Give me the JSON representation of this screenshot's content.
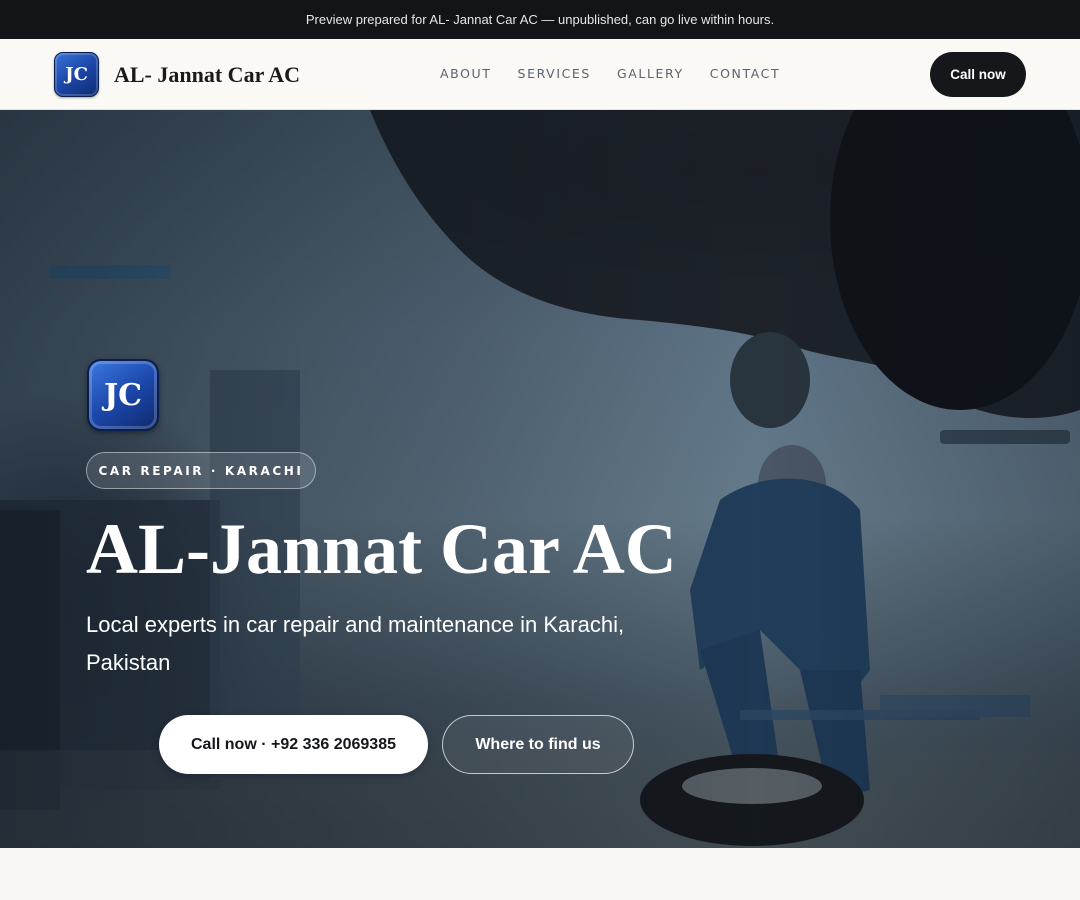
{
  "preview_bar": {
    "text": "Preview prepared for AL- Jannat Car AC — unpublished, can go live within hours."
  },
  "header": {
    "logo_initials": "JC",
    "brand_name": "AL- Jannat Car AC",
    "nav": [
      {
        "label": "ABOUT"
      },
      {
        "label": "SERVICES"
      },
      {
        "label": "GALLERY"
      },
      {
        "label": "CONTACT"
      }
    ],
    "call_label": "Call now"
  },
  "hero": {
    "logo_initials": "JC",
    "tag": "CAR REPAIR · KARACHI",
    "title": "AL-Jannat Car AC",
    "subtitle": "Local experts in car repair and maintenance in Karachi, Pakistan",
    "primary_cta": "Call now · +92 336 2069385",
    "secondary_cta": "Where to find us"
  },
  "colors": {
    "top_bar": "#121418",
    "page_bg": "#f8f7f4",
    "dark_button": "#15171b",
    "logo_blue": "#1c46a8",
    "nav_text": "#5b6270"
  }
}
